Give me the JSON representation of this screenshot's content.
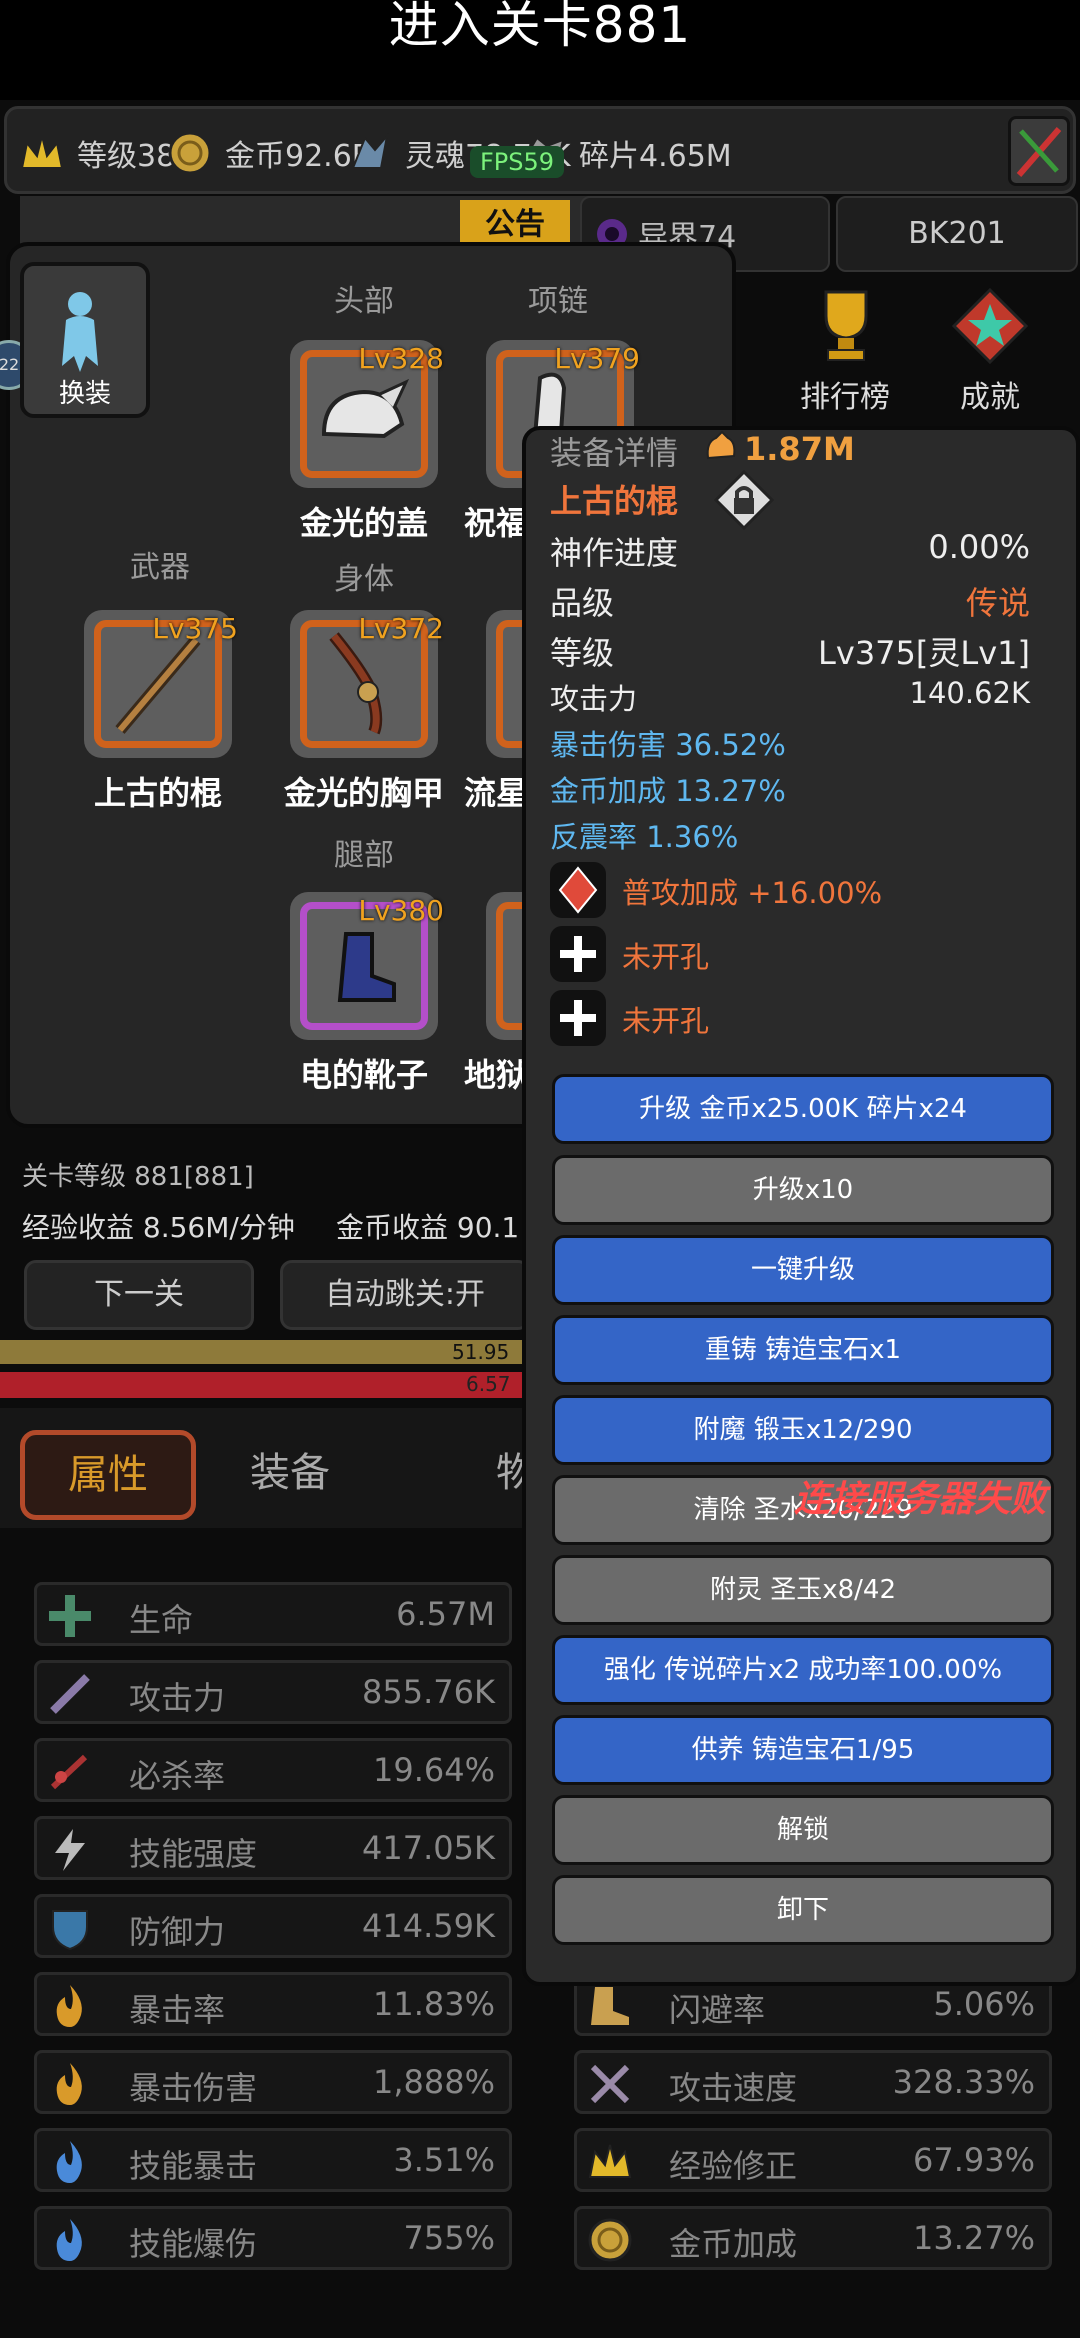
{
  "title": "进入关卡881",
  "resources": {
    "level": "等级381",
    "gold": "金币92.6B",
    "soul": "灵魂78.71K",
    "shard": "碎片4.65M"
  },
  "fps": "FPS59",
  "notice_label": "公告",
  "otherworld": "异界74",
  "bk_label": "BK201",
  "ranking_label": "排行榜",
  "achievement_label": "成就",
  "side_dot": "22",
  "equip_panel": {
    "change_outfit": "换装",
    "slot_labels": {
      "head": "头部",
      "necklace": "项链",
      "weapon": "武器",
      "body": "身体",
      "legs": "腿部"
    },
    "slots": {
      "head": {
        "level": "Lv328",
        "name": "金光的盖"
      },
      "necklace": {
        "level": "Lv379",
        "name": "祝福"
      },
      "weapon": {
        "level": "Lv375",
        "name": "上古的棍"
      },
      "body": {
        "level": "Lv372",
        "name": "金光的胸甲"
      },
      "ring": {
        "name": "流星"
      },
      "legs": {
        "level": "Lv380",
        "name": "电的靴子"
      },
      "extra": {
        "name": "地狱"
      }
    }
  },
  "detail": {
    "header": "装备详情",
    "power": "1.87M",
    "item_name": "上古的棍",
    "rows": [
      {
        "label": "神作进度",
        "value": "0.00%"
      },
      {
        "label": "品级",
        "value": "传说"
      },
      {
        "label": "等级",
        "value": "Lv375[灵Lv1]"
      },
      {
        "label": "攻击力",
        "value": "140.62K"
      }
    ],
    "bonuses": [
      "暴击伤害 36.52%",
      "金币加成 13.27%",
      "反震率 1.36%"
    ],
    "gem": "普攻加成 +16.00%",
    "socket1": "未开孔",
    "socket2": "未开孔",
    "buttons": [
      "升级 金币x25.00K 碎片x24",
      "升级x10",
      "一键升级",
      "重铸 铸造宝石x1",
      "附魔 锻玉x12/290",
      "清除 圣水x20/229",
      "附灵 圣玉x8/42",
      "强化 传说碎片x2 成功率100.00%",
      "供养 铸造宝石1/95",
      "解锁",
      "卸下"
    ]
  },
  "server_fail": "连接服务器失败",
  "stage": {
    "level": "关卡等级 881[881]",
    "exp_gain": "经验收益 8.56M/分钟",
    "gold_gain": "金币收益 90.1",
    "next": "下一关",
    "auto": "自动跳关:开",
    "exp_bar": "51.95",
    "hp_bar": "6.57",
    "exp_fill": 0.49,
    "hp_fill": 0.49
  },
  "tabs": {
    "attr": "属性",
    "equip": "装备",
    "item": "物"
  },
  "attributes_left": [
    {
      "icon": "cross-icon",
      "name": "生命",
      "value": "6.57M"
    },
    {
      "icon": "sword-icon",
      "name": "攻击力",
      "value": "855.76K"
    },
    {
      "icon": "crit-icon",
      "name": "必杀率",
      "value": "19.64%"
    },
    {
      "icon": "lightning-icon",
      "name": "技能强度",
      "value": "417.05K"
    },
    {
      "icon": "shield-icon",
      "name": "防御力",
      "value": "414.59K"
    },
    {
      "icon": "flame-icon",
      "name": "暴击率",
      "value": "11.83%"
    },
    {
      "icon": "flame-icon",
      "name": "暴击伤害",
      "value": "1,888%"
    },
    {
      "icon": "blue-flame-icon",
      "name": "技能暴击",
      "value": "3.51%"
    },
    {
      "icon": "blue-flame-icon",
      "name": "技能爆伤",
      "value": "755%"
    }
  ],
  "attributes_right": [
    {
      "icon": "boot-icon",
      "name": "闪避率",
      "value": "5.06%"
    },
    {
      "icon": "swords-icon",
      "name": "攻击速度",
      "value": "328.33%"
    },
    {
      "icon": "crown-icon",
      "name": "经验修正",
      "value": "67.93%"
    },
    {
      "icon": "coin-icon",
      "name": "金币加成",
      "value": "13.27%"
    }
  ],
  "colors": {
    "accent_orange": "#f0753c",
    "blue_text": "#5fb8f0",
    "button_blue": "#3465c7",
    "button_gray": "#6b6b6b",
    "fail_red": "#ff4a4a"
  }
}
